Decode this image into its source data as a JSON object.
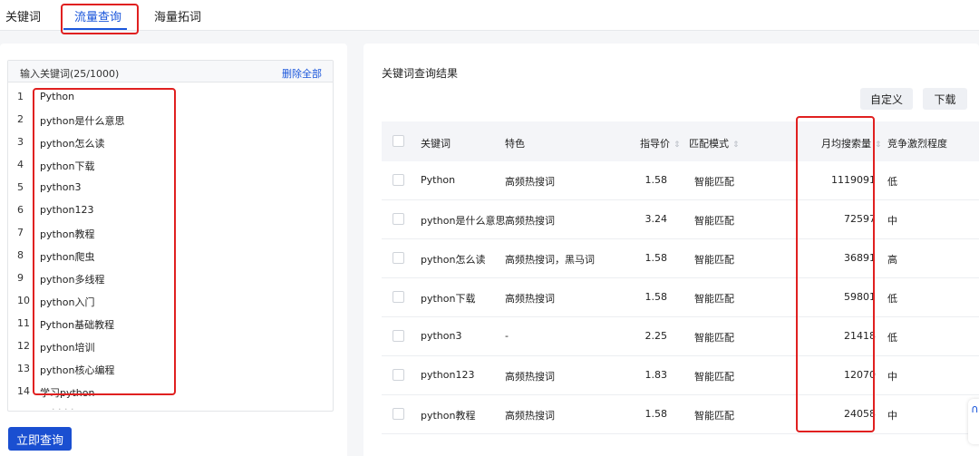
{
  "tabs": [
    "关键词",
    "流量查询",
    "海量拓词"
  ],
  "input": {
    "label": "输入关键词(25/1000)",
    "clear_all": "删除全部",
    "keywords": [
      {
        "num": "1",
        "text": "Python"
      },
      {
        "num": "2",
        "text": "python是什么意思"
      },
      {
        "num": "3",
        "text": "python怎么读"
      },
      {
        "num": "4",
        "text": "python下载"
      },
      {
        "num": "5",
        "text": "python3"
      },
      {
        "num": "6",
        "text": "python123"
      },
      {
        "num": "7",
        "text": "python教程"
      },
      {
        "num": "8",
        "text": "python爬虫"
      },
      {
        "num": "9",
        "text": "python多线程"
      },
      {
        "num": "10",
        "text": "python入门"
      },
      {
        "num": "11",
        "text": "Python基础教程"
      },
      {
        "num": "12",
        "text": "python培训"
      },
      {
        "num": "13",
        "text": "python核心编程"
      },
      {
        "num": "14",
        "text": "学习python"
      }
    ],
    "query_button": "立即查询"
  },
  "results": {
    "title": "关键词查询结果",
    "custom_button": "自定义",
    "download_button": "下载",
    "columns": {
      "keyword": "关键词",
      "feature": "特色",
      "price": "指导价",
      "mode": "匹配模式",
      "monthly": "月均搜索量",
      "competition": "竞争激烈程度"
    },
    "rows": [
      {
        "keyword": "Python",
        "feature": "高频热搜词",
        "price": "1.58",
        "mode": "智能匹配",
        "monthly": "1119091",
        "competition": "低"
      },
      {
        "keyword": "python是什么意思",
        "feature": "高频热搜词",
        "price": "3.24",
        "mode": "智能匹配",
        "monthly": "72597",
        "competition": "中"
      },
      {
        "keyword": "python怎么读",
        "feature": "高频热搜词，黑马词",
        "price": "1.58",
        "mode": "智能匹配",
        "monthly": "36891",
        "competition": "高"
      },
      {
        "keyword": "python下载",
        "feature": "高频热搜词",
        "price": "1.58",
        "mode": "智能匹配",
        "monthly": "59801",
        "competition": "低"
      },
      {
        "keyword": "python3",
        "feature": "-",
        "price": "2.25",
        "mode": "智能匹配",
        "monthly": "21418",
        "competition": "低"
      },
      {
        "keyword": "python123",
        "feature": "高频热搜词",
        "price": "1.83",
        "mode": "智能匹配",
        "monthly": "12070",
        "competition": "中"
      },
      {
        "keyword": "python教程",
        "feature": "高频热搜词",
        "price": "1.58",
        "mode": "智能匹配",
        "monthly": "24058",
        "competition": "中"
      }
    ]
  },
  "colors": {
    "accent": "#1a56db",
    "highlight_box": "#e02020",
    "button_primary": "#1a4fd1"
  }
}
